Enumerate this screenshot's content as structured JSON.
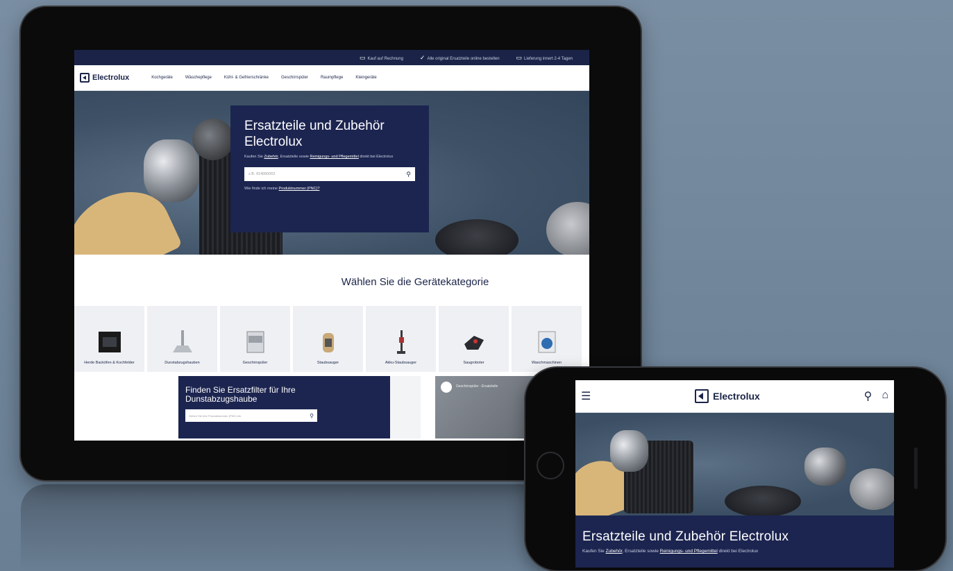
{
  "tablet": {
    "topbar": {
      "items": [
        "Kauf auf Rechnung",
        "Alle original Ersatzteile online bestellen",
        "Lieferung innert 2-4 Tagen"
      ]
    },
    "nav": {
      "brand": "Electrolux",
      "items": [
        "Kochgeräte",
        "Wäschepflege",
        "Kühl- & Gefrierschränke",
        "Geschirrspüler",
        "Raumpflege",
        "Kleingeräte"
      ]
    },
    "hero": {
      "title": "Ersatzteile und Zubehör Electrolux",
      "subtitle_prefix": "Kaufen Sie ",
      "subtitle_link1": "Zubehör",
      "subtitle_mid": ", Ersatzteile sowie ",
      "subtitle_link2": "Reinigungs- und Pflegemittel",
      "subtitle_suffix": " direkt bei Electrolux",
      "search_placeholder": "z.B. 914060002",
      "hint_prefix": "Wie finde ich meine ",
      "hint_link": "Produktnummer (PNC)?"
    },
    "categories_title": "Wählen Sie die Gerätekategorie",
    "categories": [
      {
        "label": "Herde Backöfen & Kochfelder"
      },
      {
        "label": "Dunstabzugshauben"
      },
      {
        "label": "Geschirrspüler"
      },
      {
        "label": "Staubsauger"
      },
      {
        "label": "Akku-Staubsauger"
      },
      {
        "label": "Saugroboter"
      },
      {
        "label": "Waschmaschinen"
      }
    ],
    "filter": {
      "title": "Finden Sie Ersatzfilter für Ihre Dunstabzugshaube",
      "search_placeholder": "Geben Sie Ihre Produktnummer (PNC) ein"
    },
    "video": {
      "caption": "Geschirrspüler - Ersatzteile"
    }
  },
  "phone": {
    "nav": {
      "menu_icon": "hamburger-icon",
      "brand": "Electrolux",
      "search_icon": "search-icon",
      "cart_icon": "basket-icon"
    },
    "hero": {
      "title": "Ersatzteile und Zubehör Electrolux",
      "subtitle_prefix": "Kaufen Sie ",
      "subtitle_link1": "Zubehör",
      "subtitle_mid": ", Ersatzteile sowie ",
      "subtitle_link2": "Reinigungs- und Pflegemittel",
      "subtitle_suffix": " direkt bei Electrolux"
    }
  },
  "colors": {
    "brand_navy": "#1c2550",
    "background": "#6f8499"
  }
}
